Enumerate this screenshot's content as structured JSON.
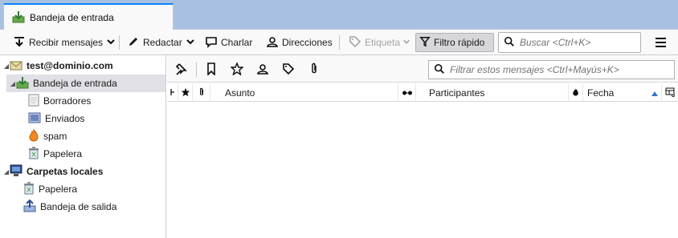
{
  "tab": {
    "label": "Bandeja de entrada",
    "icon": "inbox-icon"
  },
  "toolbar": {
    "get_messages": "Recibir mensajes",
    "compose": "Redactar",
    "chat": "Charlar",
    "address_book": "Direcciones",
    "tag": "Etiqueta",
    "quick_filter": "Filtro rápido",
    "search_placeholder": "Buscar <Ctrl+K>"
  },
  "folders": [
    {
      "label": "test@dominio.com",
      "icon": "account-icon",
      "bold": true,
      "twisty": "◢"
    },
    {
      "label": "Bandeja de entrada",
      "icon": "inbox-icon",
      "selected": true,
      "twisty": "◢"
    },
    {
      "label": "Borradores",
      "icon": "drafts-icon"
    },
    {
      "label": "Enviados",
      "icon": "sent-icon"
    },
    {
      "label": "spam",
      "icon": "spam-flame-icon"
    },
    {
      "label": "Papelera",
      "icon": "trash-icon"
    },
    {
      "label": "Carpetas locales",
      "icon": "local-folders-icon",
      "bold": true,
      "twisty": "◢"
    },
    {
      "label": "Papelera",
      "icon": "trash-icon"
    },
    {
      "label": "Bandeja de salida",
      "icon": "outbox-icon"
    }
  ],
  "quickfilter": {
    "search_placeholder": "Filtrar estos mensajes <Ctrl+Mayús+K>"
  },
  "columns": {
    "subject": "Asunto",
    "participants": "Participantes",
    "date": "Fecha"
  },
  "colors": {
    "tabstrip": "#a9c1e1",
    "accent": "#0a84ff",
    "selected_row": "#e0e0e6"
  }
}
